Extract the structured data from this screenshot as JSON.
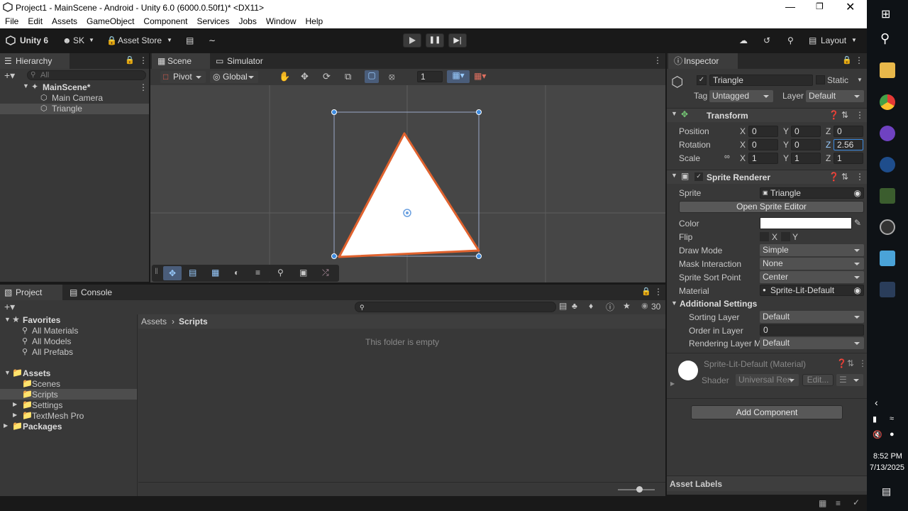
{
  "titlebar": {
    "title": "Project1 - MainScene - Android - Unity 6.0 (6000.0.50f1)* <DX11>"
  },
  "menu": [
    "File",
    "Edit",
    "Assets",
    "GameObject",
    "Component",
    "Services",
    "Jobs",
    "Window",
    "Help"
  ],
  "toolbar": {
    "brand": "Unity 6",
    "account": "SK",
    "asset_store": "Asset Store",
    "layout": "Layout"
  },
  "hierarchy": {
    "tab": "Hierarchy",
    "search_placeholder": "All",
    "scene": "MainScene*",
    "items": [
      "Main Camera",
      "Triangle"
    ]
  },
  "scene_tabs": {
    "scene": "Scene",
    "simulator": "Simulator"
  },
  "scene_toolbar": {
    "pivot": "Pivot",
    "global": "Global",
    "grid_snap": "1"
  },
  "inspector": {
    "tab": "Inspector",
    "object_name": "Triangle",
    "static": "Static",
    "tag_label": "Tag",
    "tag": "Untagged",
    "layer_label": "Layer",
    "layer": "Default",
    "transform": {
      "title": "Transform",
      "position_label": "Position",
      "position": [
        "0",
        "0",
        "0"
      ],
      "rotation_label": "Rotation",
      "rotation": [
        "0",
        "0",
        "2.56"
      ],
      "scale_label": "Scale",
      "scale": [
        "1",
        "1",
        "1"
      ]
    },
    "sprite_renderer": {
      "title": "Sprite Renderer",
      "sprite_label": "Sprite",
      "sprite": "Triangle",
      "open_editor": "Open Sprite Editor",
      "color_label": "Color",
      "color": "#ffffff",
      "flip_label": "Flip",
      "flip_x": "X",
      "flip_y": "Y",
      "draw_mode_label": "Draw Mode",
      "draw_mode": "Simple",
      "mask_label": "Mask Interaction",
      "mask": "None",
      "sort_point_label": "Sprite Sort Point",
      "sort_point": "Center",
      "material_label": "Material",
      "material": "Sprite-Lit-Default",
      "additional": "Additional Settings",
      "sorting_layer_label": "Sorting Layer",
      "sorting_layer": "Default",
      "order_label": "Order in Layer",
      "order": "0",
      "rendering_layer_label": "Rendering Layer M",
      "rendering_layer": "Default"
    },
    "material_preview": {
      "name": "Sprite-Lit-Default (Material)",
      "shader_label": "Shader",
      "shader": "Universal Ren",
      "edit": "Edit..."
    },
    "add_component": "Add Component",
    "asset_labels": "Asset Labels"
  },
  "project": {
    "tab": "Project",
    "console_tab": "Console",
    "hidden_count": "30",
    "favorites": "Favorites",
    "favorite_items": [
      "All Materials",
      "All Models",
      "All Prefabs"
    ],
    "assets": "Assets",
    "asset_folders": [
      "Scenes",
      "Scripts",
      "Settings",
      "TextMesh Pro"
    ],
    "packages": "Packages",
    "breadcrumb": [
      "Assets",
      "Scripts"
    ],
    "empty": "This folder is empty"
  },
  "clock": {
    "time": "8:52 PM",
    "date": "7/13/2025"
  }
}
